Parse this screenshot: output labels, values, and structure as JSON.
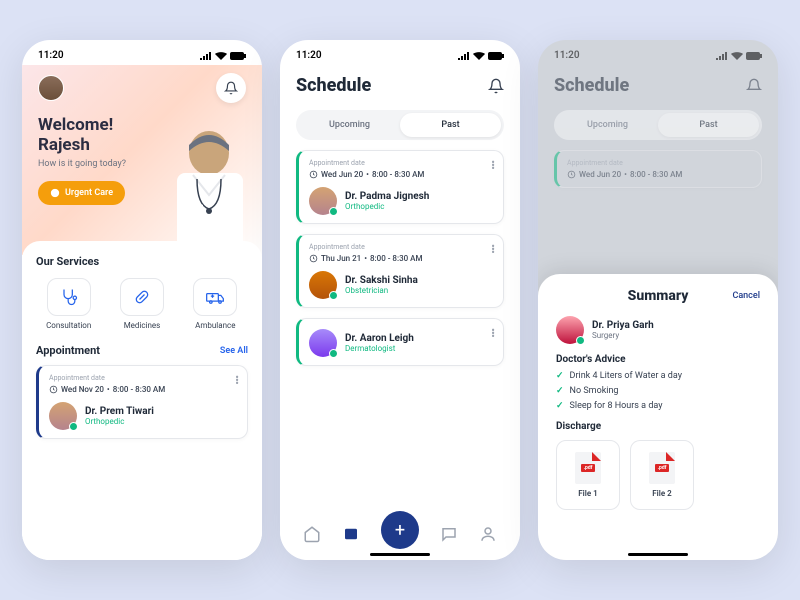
{
  "status_time": "11:20",
  "home": {
    "welcome_line1": "Welcome!",
    "welcome_line2": "Rajesh",
    "subtitle": "How is it going today?",
    "urgent_label": "Urgent Care",
    "services_title": "Our Services",
    "services": [
      {
        "label": "Consultation"
      },
      {
        "label": "Medicines"
      },
      {
        "label": "Ambulance"
      }
    ],
    "appointment_title": "Appointment",
    "see_all": "See All",
    "appointment": {
      "date_label": "Appointment date",
      "date": "Wed Nov 20",
      "time": "8:00 - 8:30 AM",
      "doctor": "Dr. Prem Tiwari",
      "speciality": "Orthopedic"
    }
  },
  "schedule": {
    "title": "Schedule",
    "tab_upcoming": "Upcoming",
    "tab_past": "Past",
    "items": [
      {
        "date_label": "Appointment date",
        "date": "Wed Jun 20",
        "time": "8:00 - 8:30 AM",
        "doctor": "Dr. Padma Jignesh",
        "speciality": "Orthopedic"
      },
      {
        "date_label": "Appointment date",
        "date": "Thu Jun 21",
        "time": "8:00 - 8:30 AM",
        "doctor": "Dr. Sakshi Sinha",
        "speciality": "Obstetrician"
      },
      {
        "date_label": "",
        "date": "",
        "time": "",
        "doctor": "Dr. Aaron Leigh",
        "speciality": "Dermatologist"
      }
    ]
  },
  "summary": {
    "title": "Summary",
    "cancel": "Cancel",
    "doctor": "Dr. Priya Garh",
    "speciality": "Surgery",
    "advice_title": "Doctor's Advice",
    "advice": [
      "Drink 4 Liters of Water a day",
      "No Smoking",
      "Sleep for 8 Hours a day"
    ],
    "discharge_title": "Discharge",
    "files": [
      "File 1",
      "File 2"
    ],
    "pdf_ext": ".pdf"
  }
}
